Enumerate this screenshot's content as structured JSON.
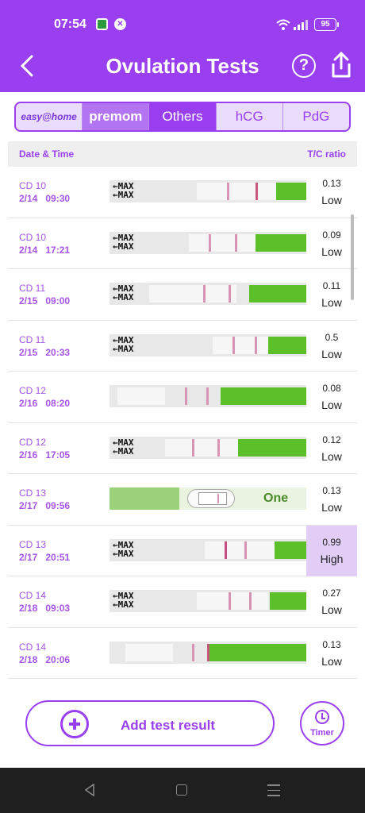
{
  "status_bar": {
    "time": "07:54",
    "battery": "95"
  },
  "header": {
    "title": "Ovulation Tests",
    "help_glyph": "?"
  },
  "segments": [
    {
      "label": "easy@home",
      "active": false
    },
    {
      "label": "premom",
      "active": false
    },
    {
      "label": "Others",
      "active": true
    },
    {
      "label": "hCG",
      "active": false
    },
    {
      "label": "PdG",
      "active": false
    }
  ],
  "table": {
    "col_date": "Date & Time",
    "col_ratio": "T/C ratio",
    "rows": [
      {
        "cd": "CD 10",
        "date": "2/14",
        "time": "09:30",
        "ratio": "0.13",
        "level": "Low"
      },
      {
        "cd": "CD 10",
        "date": "2/14",
        "time": "17:21",
        "ratio": "0.09",
        "level": "Low"
      },
      {
        "cd": "CD 11",
        "date": "2/15",
        "time": "09:00",
        "ratio": "0.11",
        "level": "Low"
      },
      {
        "cd": "CD 11",
        "date": "2/15",
        "time": "20:33",
        "ratio": "0.5",
        "level": "Low"
      },
      {
        "cd": "CD 12",
        "date": "2/16",
        "time": "08:20",
        "ratio": "0.08",
        "level": "Low"
      },
      {
        "cd": "CD 12",
        "date": "2/16",
        "time": "17:05",
        "ratio": "0.12",
        "level": "Low"
      },
      {
        "cd": "CD 13",
        "date": "2/17",
        "time": "09:56",
        "ratio": "0.13",
        "level": "Low"
      },
      {
        "cd": "CD 13",
        "date": "2/17",
        "time": "20:51",
        "ratio": "0.99",
        "level": "High"
      },
      {
        "cd": "CD 14",
        "date": "2/18",
        "time": "09:03",
        "ratio": "0.27",
        "level": "Low"
      },
      {
        "cd": "CD 14",
        "date": "2/18",
        "time": "20:06",
        "ratio": "0.13",
        "level": "Low"
      }
    ]
  },
  "strip_text": "MAX",
  "strip_brand": "One",
  "actions": {
    "add_label": "Add test result",
    "timer_label": "Timer"
  },
  "colors": {
    "accent": "#9a3ff0",
    "high_bg": "#e2cdf7",
    "strip_green": "#5bbf2a"
  }
}
